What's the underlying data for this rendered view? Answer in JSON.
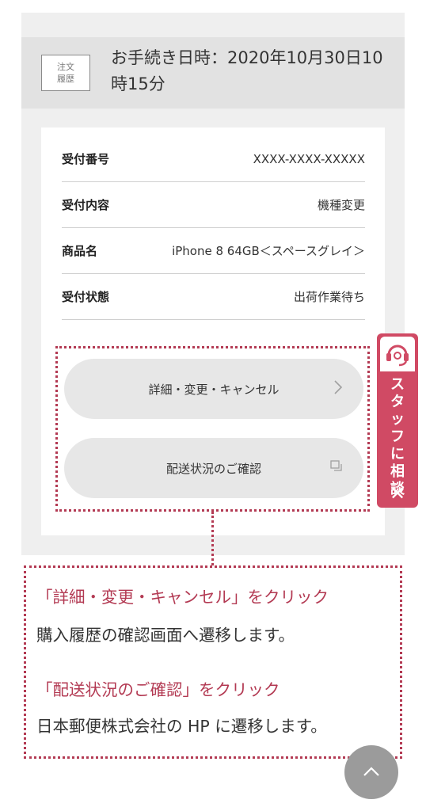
{
  "header": {
    "badge_line1": "注文",
    "badge_line2": "履歴",
    "title": "お手続き日時：2020年10月30日10時15分"
  },
  "details": [
    {
      "label": "受付番号",
      "value": "XXXX-XXXX-XXXXX"
    },
    {
      "label": "受付内容",
      "value": "機種変更"
    },
    {
      "label": "商品名",
      "value": "iPhone 8 64GB＜スペースグレイ＞"
    },
    {
      "label": "受付状態",
      "value": "出荷作業待ち"
    }
  ],
  "buttons": {
    "detail_label": "詳細・変更・キャンセル",
    "shipping_label": "配送状況のご確認"
  },
  "notes": {
    "line1": "「詳細・変更・キャンセル」をクリック",
    "line2": "購入履歴の確認画面へ遷移します。",
    "line3": "「配送状況のご確認」をクリック",
    "line4": "日本郵便株式会社の HP に遷移します。"
  },
  "staff_tab": {
    "label": "スタッフに相談",
    "close": "✕"
  },
  "colors": {
    "accent": "#b33a53",
    "tab": "#d04a64",
    "panel": "#efefef",
    "header": "#e2e2e2",
    "pill": "#e7e7e7"
  }
}
